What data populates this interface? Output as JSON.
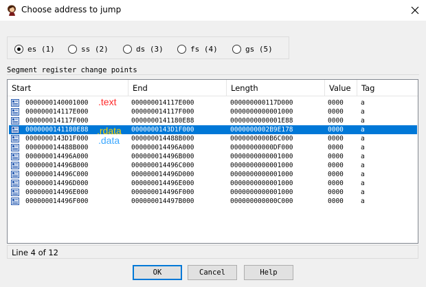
{
  "window": {
    "title": "Choose address to jump",
    "close_glyph": "✕"
  },
  "segments": {
    "options": [
      {
        "label": "es (1)",
        "selected": true
      },
      {
        "label": "ss (2)",
        "selected": false
      },
      {
        "label": "ds (3)",
        "selected": false
      },
      {
        "label": "fs (4)",
        "selected": false
      },
      {
        "label": "gs (5)",
        "selected": false
      }
    ]
  },
  "group": {
    "label": "Segment register change points"
  },
  "table": {
    "columns": [
      "Start",
      "End",
      "Length",
      "Value",
      "Tag"
    ],
    "rows": [
      {
        "start": "0000000140001000",
        "end": "000000014117E000",
        "length": "000000000117D000",
        "value": "0000",
        "tag": "a",
        "selected": false
      },
      {
        "start": "000000014117E000",
        "end": "000000014117F000",
        "length": "0000000000001000",
        "value": "0000",
        "tag": "a",
        "selected": false
      },
      {
        "start": "000000014117F000",
        "end": "0000000141180E88",
        "length": "0000000000001E88",
        "value": "0000",
        "tag": "a",
        "selected": false
      },
      {
        "start": "0000000141180E88",
        "end": "0000000143D1F000",
        "length": "0000000002B9E178",
        "value": "0000",
        "tag": "a",
        "selected": true
      },
      {
        "start": "0000000143D1F000",
        "end": "000000014488B000",
        "length": "0000000000B6C000",
        "value": "0000",
        "tag": "a",
        "selected": false
      },
      {
        "start": "000000014488B000",
        "end": "000000014496A000",
        "length": "00000000000DF000",
        "value": "0000",
        "tag": "a",
        "selected": false
      },
      {
        "start": "000000014496A000",
        "end": "000000014496B000",
        "length": "0000000000001000",
        "value": "0000",
        "tag": "a",
        "selected": false
      },
      {
        "start": "000000014496B000",
        "end": "000000014496C000",
        "length": "0000000000001000",
        "value": "0000",
        "tag": "a",
        "selected": false
      },
      {
        "start": "000000014496C000",
        "end": "000000014496D000",
        "length": "0000000000001000",
        "value": "0000",
        "tag": "a",
        "selected": false
      },
      {
        "start": "000000014496D000",
        "end": "000000014496E000",
        "length": "0000000000001000",
        "value": "0000",
        "tag": "a",
        "selected": false
      },
      {
        "start": "000000014496E000",
        "end": "000000014496F000",
        "length": "0000000000001000",
        "value": "0000",
        "tag": "a",
        "selected": false
      },
      {
        "start": "000000014496F000",
        "end": "000000014497B000",
        "length": "000000000000C000",
        "value": "0000",
        "tag": "a",
        "selected": false
      }
    ]
  },
  "annotations": [
    {
      "text": ".text",
      "color": "#ff2a2a"
    },
    {
      "text": ".rdata",
      "color": "#ffd400"
    },
    {
      "text": ".data",
      "color": "#3aa7ff"
    }
  ],
  "status": {
    "text": "Line 4 of 12"
  },
  "buttons": {
    "ok": "OK",
    "cancel": "Cancel",
    "help": "Help"
  }
}
